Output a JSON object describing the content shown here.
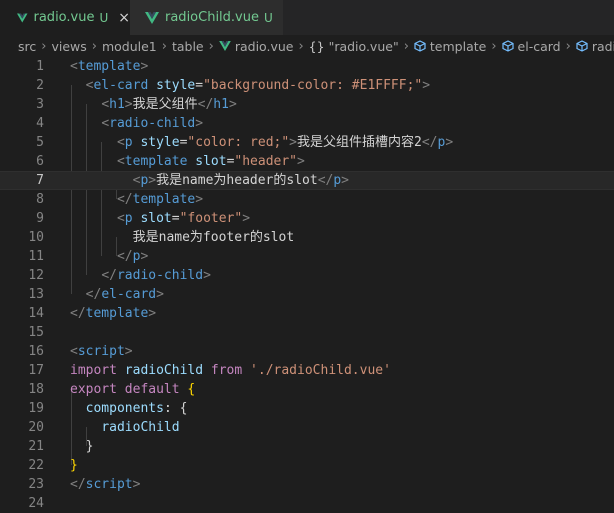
{
  "tabs": [
    {
      "label": "radio.vue",
      "status": "U",
      "active": true,
      "close": "×"
    },
    {
      "label": "radioChild.vue",
      "status": "U",
      "active": false
    }
  ],
  "breadcrumb": {
    "items": [
      "src",
      "views",
      "module1",
      "table",
      "radio.vue",
      "\"radio.vue\"",
      "template",
      "el-card",
      "radio-c"
    ],
    "symbol_braces": "{}"
  },
  "editor": {
    "current_line": 7,
    "lines": [
      {
        "n": "1"
      },
      {
        "n": "2"
      },
      {
        "n": "3"
      },
      {
        "n": "4"
      },
      {
        "n": "5"
      },
      {
        "n": "6"
      },
      {
        "n": "7"
      },
      {
        "n": "8"
      },
      {
        "n": "9"
      },
      {
        "n": "10"
      },
      {
        "n": "11"
      },
      {
        "n": "12"
      },
      {
        "n": "13"
      },
      {
        "n": "14"
      },
      {
        "n": "15"
      },
      {
        "n": "16"
      },
      {
        "n": "17"
      },
      {
        "n": "18"
      },
      {
        "n": "19"
      },
      {
        "n": "20"
      },
      {
        "n": "21"
      },
      {
        "n": "22"
      },
      {
        "n": "23"
      },
      {
        "n": "24"
      }
    ],
    "text": {
      "l1_tag": "template",
      "l2_tag": "el-card",
      "l2_attr": "style",
      "l2_val": "\"background-color: #E1FFFF;\"",
      "l3_tag": "h1",
      "l3_text": "我是父组件",
      "l4_tag": "radio-child",
      "l5_tag": "p",
      "l5_attr": "style",
      "l5_val": "\"color: red;\"",
      "l5_text": "我是父组件插槽内容2",
      "l6_tag": "template",
      "l6_attr": "slot",
      "l6_val": "\"header\"",
      "l7_tag": "p",
      "l7_text": "我是name为header的slot",
      "l8_tag": "template",
      "l9_tag": "p",
      "l9_attr": "slot",
      "l9_val": "\"footer\"",
      "l10_text": "我是name为footer的slot",
      "l11_tag": "p",
      "l12_tag": "radio-child",
      "l13_tag": "el-card",
      "l14_tag": "template",
      "l16_tag": "script",
      "l17_import": "import",
      "l17_name": "radioChild",
      "l17_from": "from",
      "l17_path": "'./radioChild.vue'",
      "l18_export": "export",
      "l18_default": "default",
      "l18_brace": "{",
      "l19_key": "components",
      "l19_rest": ": {",
      "l20_name": "radioChild",
      "l21_brace": "}",
      "l22_brace": "}",
      "l23_tag": "script"
    }
  },
  "colors": {
    "background": "#1e1e1e",
    "tag": "#569cd6",
    "attribute": "#9cdcfe",
    "string": "#ce9178",
    "keyword": "#c586c0",
    "untracked": "#73c991"
  }
}
